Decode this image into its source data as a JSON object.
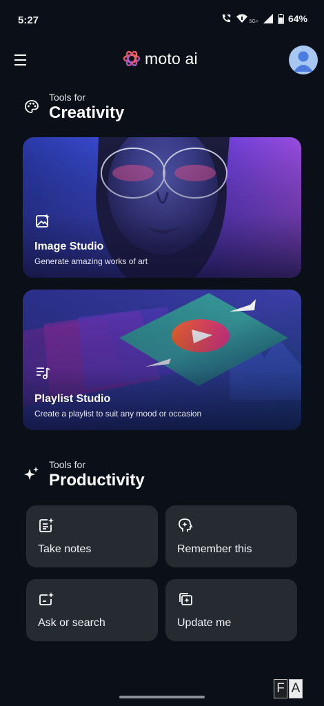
{
  "status_bar": {
    "time": "5:27",
    "network": "5G+",
    "battery": "64%",
    "icons": [
      "wifi-calling-icon",
      "wifi-icon",
      "signal-icon",
      "battery-icon"
    ]
  },
  "app_bar": {
    "brand": "moto ai",
    "menu_icon": "hamburger-menu-icon",
    "avatar_icon": "profile-avatar-icon"
  },
  "creativity": {
    "pre": "Tools for",
    "title": "Creativity",
    "icon": "palette-icon",
    "cards": [
      {
        "title": "Image Studio",
        "subtitle": "Generate amazing works of art",
        "icon": "image-sparkle-icon"
      },
      {
        "title": "Playlist Studio",
        "subtitle": "Create a playlist to suit any mood or occasion",
        "icon": "playlist-music-icon"
      }
    ]
  },
  "productivity": {
    "pre": "Tools for",
    "title": "Productivity",
    "icon": "sparkles-icon",
    "tiles": [
      {
        "label": "Take notes",
        "icon": "notes-sparkle-icon"
      },
      {
        "label": "Remember this",
        "icon": "head-sparkle-icon"
      },
      {
        "label": "Ask or search",
        "icon": "ask-search-icon"
      },
      {
        "label": "Update me",
        "icon": "update-cards-icon"
      }
    ]
  },
  "watermark": {
    "left": "F",
    "right": "A"
  },
  "colors": {
    "background": "#0b1018",
    "tile": "#262a31",
    "brand_accent": "#ff5a3d",
    "avatar": "#a9c7f3"
  }
}
